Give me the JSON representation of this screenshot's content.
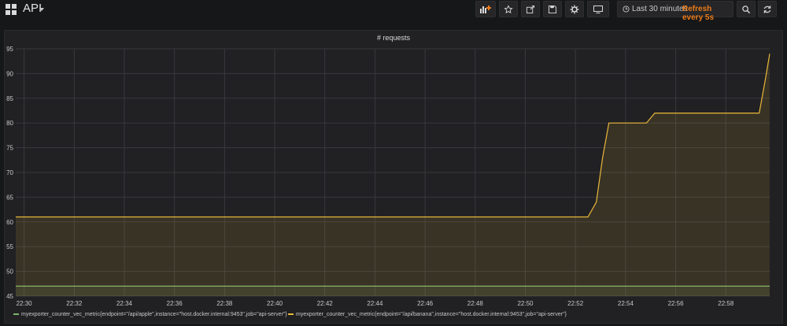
{
  "dashboard": {
    "title": "API"
  },
  "toolbar": {
    "buttons": [
      {
        "name": "add-panel-button",
        "icon": "add-panel-icon"
      },
      {
        "name": "star-button",
        "icon": "star-icon"
      },
      {
        "name": "share-button",
        "icon": "share-icon"
      },
      {
        "name": "save-button",
        "icon": "save-icon"
      },
      {
        "name": "settings-button",
        "icon": "gear-icon"
      },
      {
        "name": "tv-mode-button",
        "icon": "monitor-icon"
      },
      {
        "name": "zoom-out-button",
        "icon": "search-icon"
      },
      {
        "name": "refresh-button",
        "icon": "refresh-icon"
      }
    ],
    "time_range": "Last 30 minutes",
    "refresh": "Refresh every 5s"
  },
  "colors": {
    "accent": "#eb7b18",
    "series_green": "#7eb26d",
    "series_yellow": "#eab839"
  },
  "chart_data": {
    "type": "area",
    "title": "# requests",
    "xlabel": "",
    "ylabel": "",
    "x_ticks": [
      "22:30",
      "22:32",
      "22:34",
      "22:36",
      "22:38",
      "22:40",
      "22:42",
      "22:44",
      "22:46",
      "22:48",
      "22:50",
      "22:52",
      "22:54",
      "22:56",
      "22:58"
    ],
    "y_ticks": [
      45,
      50,
      55,
      60,
      65,
      70,
      75,
      80,
      85,
      90,
      95
    ],
    "ylim": [
      45,
      95
    ],
    "grid": true,
    "legend_position": "bottom-left",
    "series": [
      {
        "name": "myexporter_counter_vec_metric{endpoint=\"/api/apple\",instance=\"host.docker.internal:9453\",job=\"api-server\"}",
        "color": "#7eb26d",
        "points": [
          [
            "22:29:40",
            47
          ],
          [
            "22:59:45",
            47
          ]
        ]
      },
      {
        "name": "myexporter_counter_vec_metric{endpoint=\"/api/banana\",instance=\"host.docker.internal:9453\",job=\"api-server\"}",
        "color": "#eab839",
        "points": [
          [
            "22:29:40",
            61
          ],
          [
            "22:52:30",
            61
          ],
          [
            "22:52:50",
            64
          ],
          [
            "22:53:05",
            73
          ],
          [
            "22:53:20",
            80
          ],
          [
            "22:54:50",
            80
          ],
          [
            "22:55:10",
            82
          ],
          [
            "22:59:20",
            82
          ],
          [
            "22:59:35",
            89
          ],
          [
            "22:59:45",
            94
          ]
        ]
      }
    ]
  }
}
